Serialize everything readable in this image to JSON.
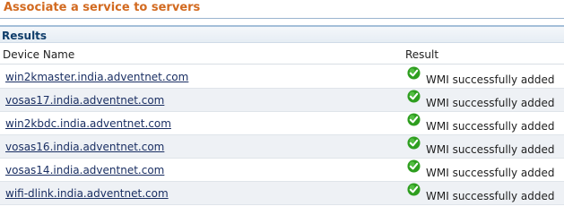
{
  "page": {
    "title": "Associate a service to servers"
  },
  "results": {
    "label": "Results",
    "columns": {
      "device": "Device Name",
      "result": "Result"
    },
    "rows": [
      {
        "device": "win2kmaster.india.adventnet.com",
        "result": "WMI successfully added",
        "icon": "check-icon"
      },
      {
        "device": "vosas17.india.adventnet.com",
        "result": "WMI successfully added",
        "icon": "check-icon"
      },
      {
        "device": "win2kbdc.india.adventnet.com",
        "result": "WMI successfully added",
        "icon": "check-icon"
      },
      {
        "device": "vosas16.india.adventnet.com",
        "result": "WMI successfully added",
        "icon": "check-icon"
      },
      {
        "device": "vosas14.india.adventnet.com",
        "result": "WMI successfully added",
        "icon": "check-icon"
      },
      {
        "device": "wifi-dlink.india.adventnet.com",
        "result": "WMI successfully added",
        "icon": "check-icon"
      }
    ]
  },
  "colors": {
    "title": "#d26a20",
    "section_label": "#0f3d6a",
    "link": "#1a2f63",
    "success": "#2e9e1f",
    "row_alt": "#eef1f5"
  }
}
